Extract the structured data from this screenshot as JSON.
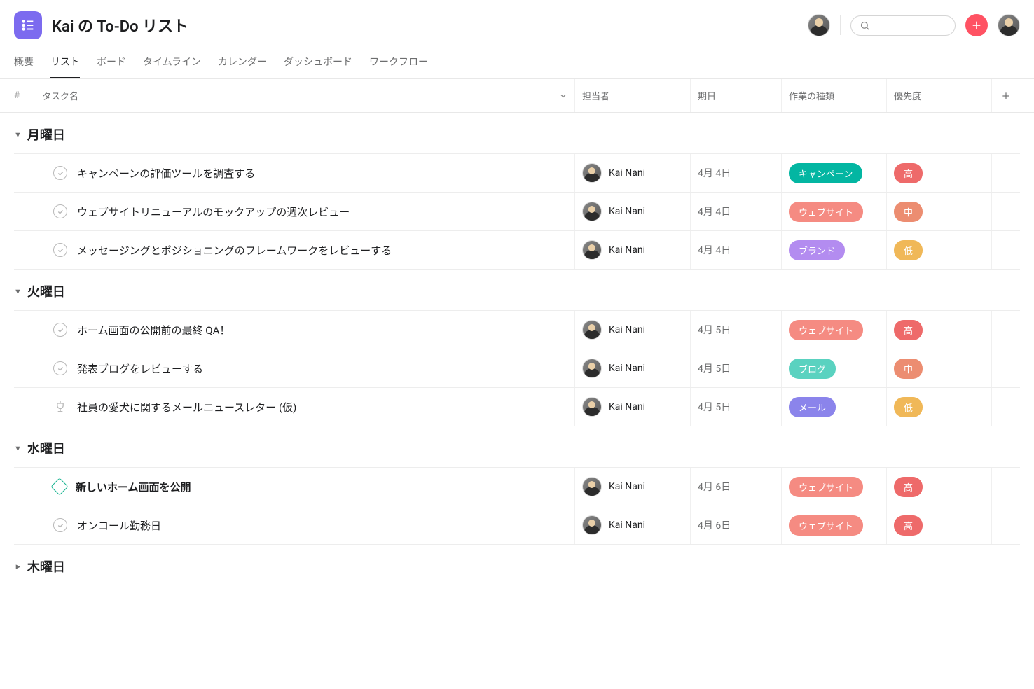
{
  "header": {
    "title": "Kai の To-Do リスト",
    "search_placeholder": ""
  },
  "tabs": [
    {
      "label": "概要",
      "active": false
    },
    {
      "label": "リスト",
      "active": true
    },
    {
      "label": "ボード",
      "active": false
    },
    {
      "label": "タイムライン",
      "active": false
    },
    {
      "label": "カレンダー",
      "active": false
    },
    {
      "label": "ダッシュボード",
      "active": false
    },
    {
      "label": "ワークフロー",
      "active": false
    }
  ],
  "columns": {
    "num": "#",
    "task": "タスク名",
    "assignee": "担当者",
    "date": "期日",
    "worktype": "作業の種類",
    "priority": "優先度"
  },
  "tag_colors": {
    "キャンペーン": "#03b6a2",
    "ウェブサイト": "#f58b82",
    "ブランド": "#b38cf0",
    "ブログ": "#5ad2c0",
    "メール": "#8b84eb",
    "高": "#ee6a6a",
    "中": "#ec8d71",
    "低": "#f0b858"
  },
  "sections": [
    {
      "title": "月曜日",
      "collapsed": false,
      "tasks": [
        {
          "icon": "check",
          "name": "キャンペーンの評価ツールを調査する",
          "bold": false,
          "assignee": "Kai Nani",
          "date": "4月 4日",
          "worktype": "キャンペーン",
          "priority": "高"
        },
        {
          "icon": "check",
          "name": "ウェブサイトリニューアルのモックアップの週次レビュー",
          "bold": false,
          "assignee": "Kai Nani",
          "date": "4月 4日",
          "worktype": "ウェブサイト",
          "priority": "中"
        },
        {
          "icon": "check",
          "name": "メッセージングとポジショニングのフレームワークをレビューする",
          "bold": false,
          "assignee": "Kai Nani",
          "date": "4月 4日",
          "worktype": "ブランド",
          "priority": "低"
        }
      ]
    },
    {
      "title": "火曜日",
      "collapsed": false,
      "tasks": [
        {
          "icon": "check",
          "name": "ホーム画面の公開前の最終 QA！",
          "bold": false,
          "assignee": "Kai Nani",
          "date": "4月 5日",
          "worktype": "ウェブサイト",
          "priority": "高"
        },
        {
          "icon": "check",
          "name": "発表ブログをレビューする",
          "bold": false,
          "assignee": "Kai Nani",
          "date": "4月 5日",
          "worktype": "ブログ",
          "priority": "中"
        },
        {
          "icon": "approval",
          "name": "社員の愛犬に関するメールニュースレター (仮)",
          "bold": false,
          "assignee": "Kai Nani",
          "date": "4月 5日",
          "worktype": "メール",
          "priority": "低"
        }
      ]
    },
    {
      "title": "水曜日",
      "collapsed": false,
      "tasks": [
        {
          "icon": "milestone",
          "name": "新しいホーム画面を公開",
          "bold": true,
          "assignee": "Kai Nani",
          "date": "4月 6日",
          "worktype": "ウェブサイト",
          "priority": "高"
        },
        {
          "icon": "check",
          "name": "オンコール勤務日",
          "bold": false,
          "assignee": "Kai Nani",
          "date": "4月 6日",
          "worktype": "ウェブサイト",
          "priority": "高"
        }
      ]
    },
    {
      "title": "木曜日",
      "collapsed": true,
      "tasks": []
    }
  ]
}
